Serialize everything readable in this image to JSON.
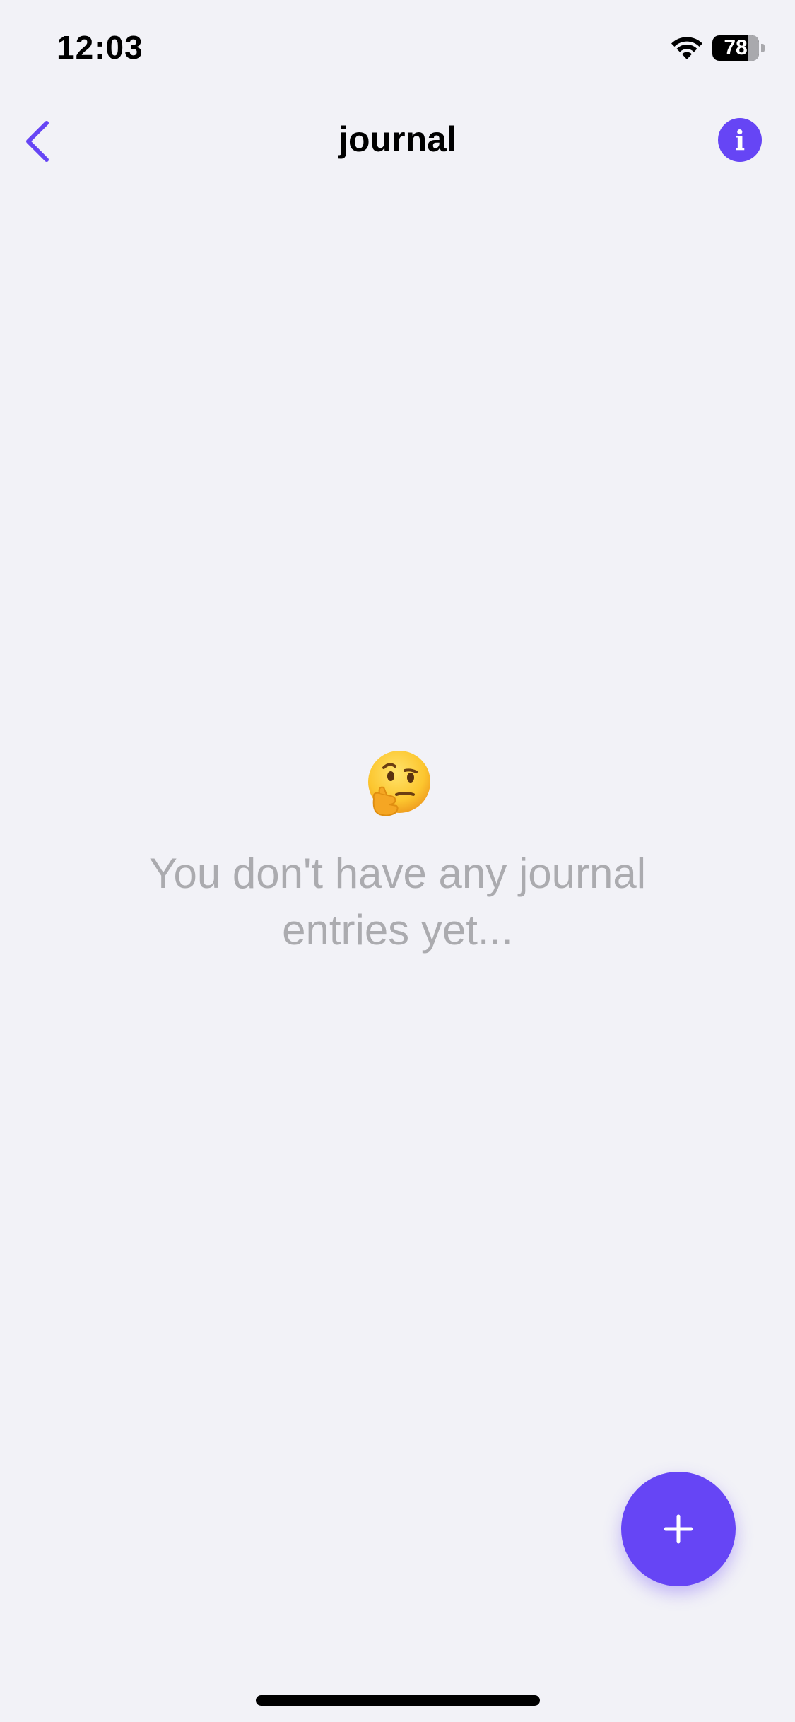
{
  "status_bar": {
    "time": "12:03",
    "battery_level": "78",
    "battery_fraction": 0.78
  },
  "nav": {
    "title": "journal",
    "info_glyph": "i"
  },
  "empty_state": {
    "emoji": "thinking-face",
    "message": "You don't have any journal entries yet..."
  },
  "icons": {
    "back": "chevron-left-icon",
    "info": "info-icon",
    "add": "plus-icon",
    "wifi": "wifi-icon",
    "battery": "battery-icon"
  },
  "colors": {
    "accent": "#6645f5",
    "background": "#f2f2f7",
    "muted_text": "#ababaf"
  }
}
